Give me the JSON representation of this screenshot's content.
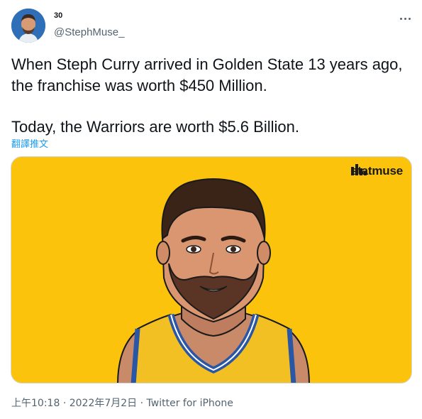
{
  "user": {
    "display_name": "30",
    "handle": "@StephMuse_",
    "avatar_icon": "player-avatar-icon"
  },
  "tweet": {
    "paragraph_1": "When Steph Curry arrived in Golden State 13 years ago, the franchise was worth $450 Million.",
    "paragraph_2": "Today, the Warriors are worth $5.6 Billion.",
    "translate_label": "翻譯推文"
  },
  "media": {
    "brand": "statmuse",
    "brand_icon": "statmuse-bars-icon",
    "background_color": "#fcc30d",
    "jersey_color": "#f2c022",
    "jersey_trim_color": "#2a56a6"
  },
  "meta": {
    "time": "上午10:18",
    "date": "2022年7月2日",
    "separator": "·",
    "source": "Twitter for iPhone"
  },
  "colors": {
    "accent": "#1d9bf0",
    "secondary_text": "#536471"
  }
}
